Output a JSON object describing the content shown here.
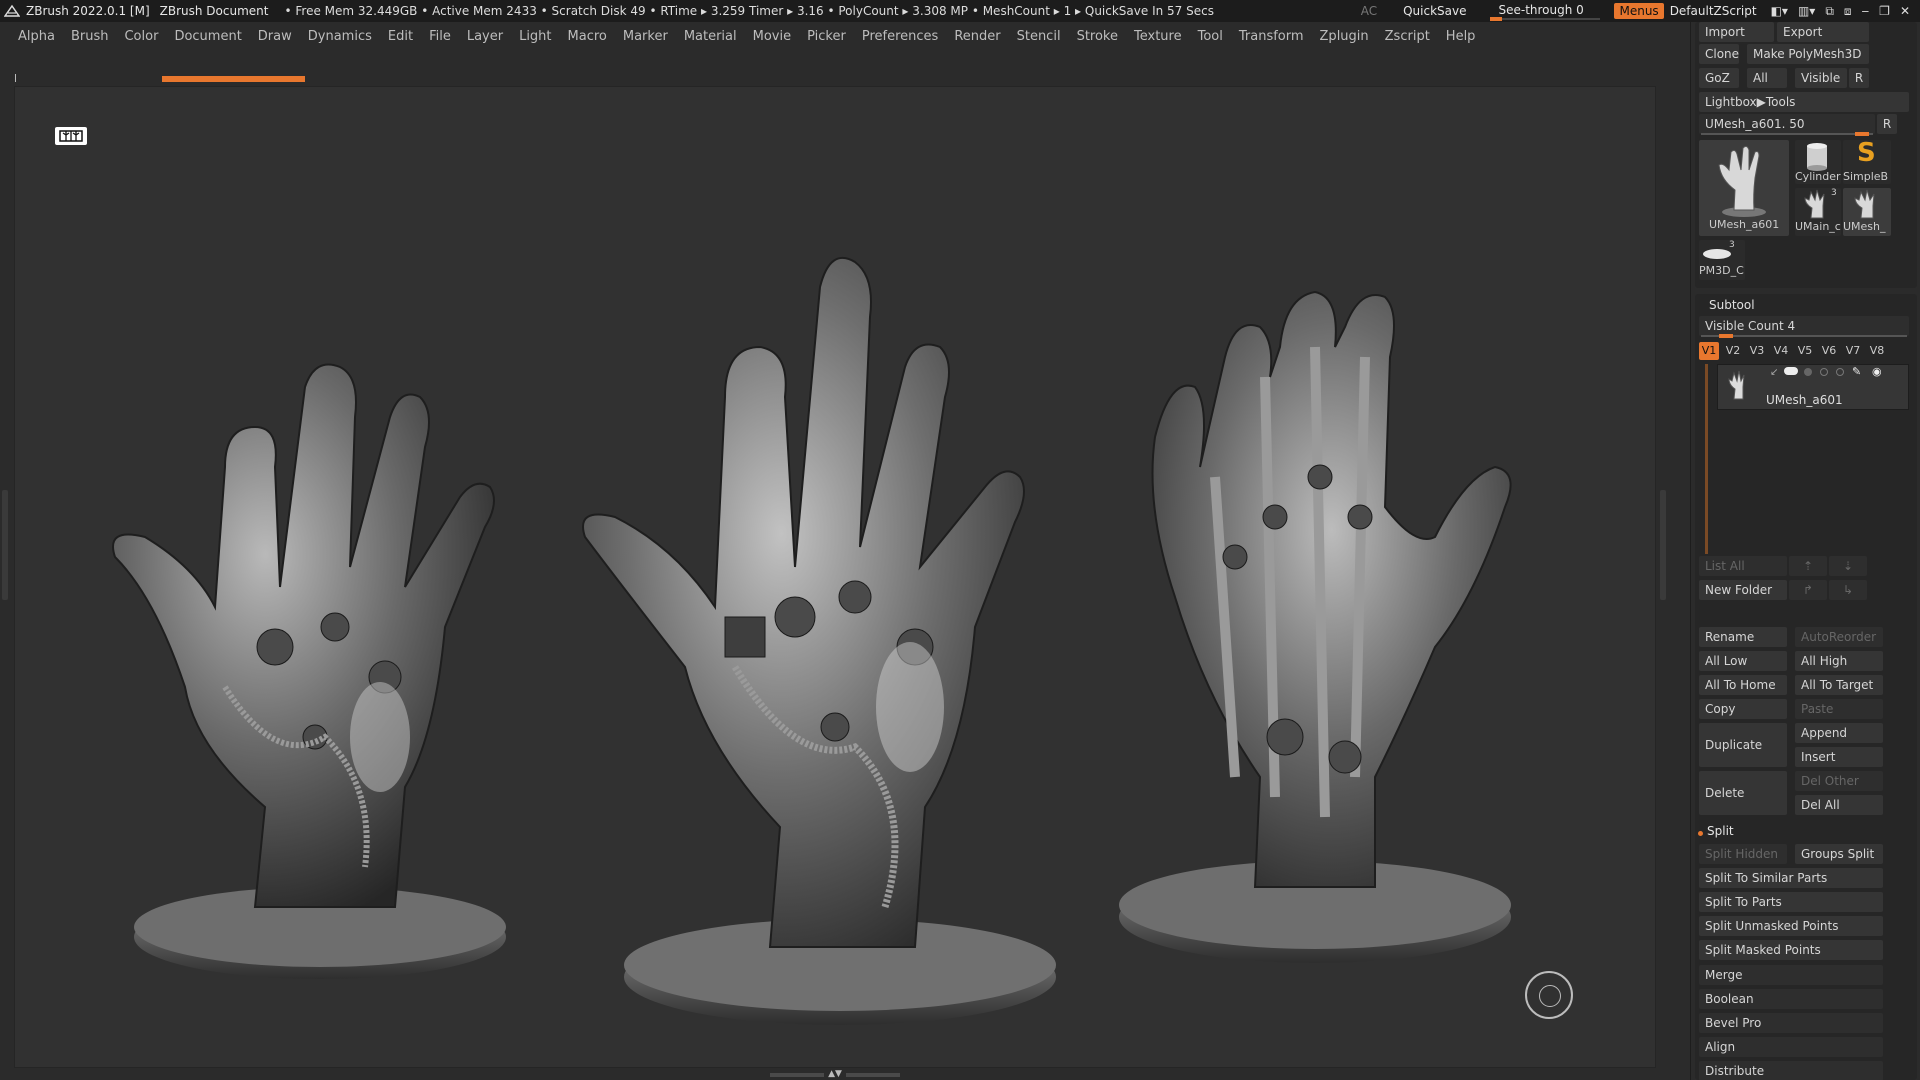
{
  "titlebar": {
    "app": "ZBrush 2022.0.1 [M]",
    "document": "ZBrush Document",
    "stats": "• Free Mem 32.449GB • Active Mem 2433 • Scratch Disk 49 •  RTime ▸ 3.259 Timer ▸ 3.16 • PolyCount ▸ 3.308 MP  • MeshCount ▸ 1  ▸ QuickSave In 57 Secs",
    "ac": "AC",
    "quicksave": "QuickSave",
    "see_through": "See-through   0",
    "menus": "Menus",
    "default_zscript": "DefaultZScript"
  },
  "menus": [
    "Alpha",
    "Brush",
    "Color",
    "Document",
    "Draw",
    "Dynamics",
    "Edit",
    "File",
    "Layer",
    "Light",
    "Macro",
    "Marker",
    "Material",
    "Movie",
    "Picker",
    "Preferences",
    "Render",
    "Stencil",
    "Stroke",
    "Texture",
    "Tool",
    "Transform",
    "Zplugin",
    "Zscript",
    "Help"
  ],
  "tool_panel": {
    "import": "Import",
    "export": "Export",
    "clone": "Clone",
    "make_polymesh": "Make PolyMesh3D",
    "goz": "GoZ",
    "all": "All",
    "visible": "Visible",
    "r": "R",
    "lightbox_tools": "Lightbox▶Tools",
    "current_tool": "UMesh_a601. 50",
    "thumbs": {
      "main": "UMesh_a601",
      "cylinder": "Cylinder",
      "simpleb": "SimpleB",
      "umain": "UMain_c",
      "umesh": "UMesh_",
      "pm3d": "PM3D_C",
      "umain_count": "3",
      "pm3d_count": "3"
    }
  },
  "subtool": {
    "title": "Subtool",
    "visible_count": "Visible Count 4",
    "tabs": [
      "V1",
      "V2",
      "V3",
      "V4",
      "V5",
      "V6",
      "V7",
      "V8"
    ],
    "item_name": "UMesh_a601",
    "list_all": "List All",
    "new_folder": "New Folder",
    "rename": "Rename",
    "auto_reorder": "AutoReorder",
    "all_low": "All Low",
    "all_high": "All High",
    "all_to_home": "All To Home",
    "all_to_target": "All To Target",
    "copy": "Copy",
    "paste": "Paste",
    "duplicate": "Duplicate",
    "append": "Append",
    "insert": "Insert",
    "delete": "Delete",
    "del_other": "Del Other",
    "del_all": "Del All",
    "split": "Split",
    "split_hidden": "Split Hidden",
    "groups_split": "Groups Split",
    "split_similar": "Split To Similar Parts",
    "split_parts": "Split To Parts",
    "split_unmasked": "Split Unmasked Points",
    "split_masked": "Split Masked Points",
    "merge": "Merge",
    "boolean": "Boolean",
    "bevel_pro": "Bevel Pro",
    "align": "Align",
    "distribute": "Distribute"
  }
}
